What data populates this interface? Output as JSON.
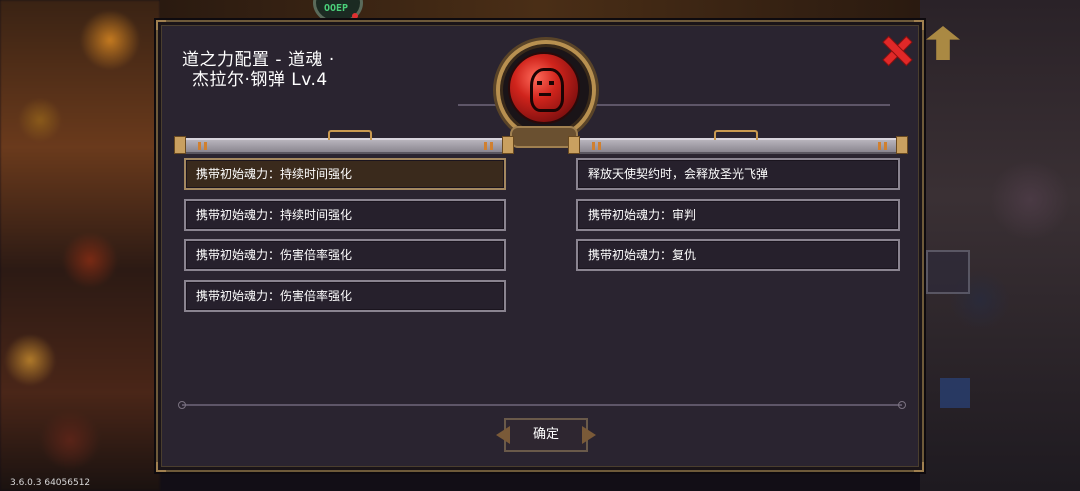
{
  "dialog": {
    "title_line1": "道之力配置 - 道魂 ·",
    "title_line2": "杰拉尔·钢弹 Lv.4",
    "confirm_label": "确定"
  },
  "left_column": [
    {
      "label": "携带初始魂力：持续时间强化",
      "selected": true
    },
    {
      "label": "携带初始魂力：持续时间强化",
      "selected": false
    },
    {
      "label": "携带初始魂力：伤害倍率强化",
      "selected": false
    },
    {
      "label": "携带初始魂力：伤害倍率强化",
      "selected": false
    }
  ],
  "right_column": [
    {
      "label": "释放天使契约时，会释放圣光飞弹"
    },
    {
      "label": "携带初始魂力：审判"
    },
    {
      "label": "携带初始魂力：复仇"
    }
  ],
  "top_badge_text": "OOEP",
  "version_text": "3.6.0.3 64056512",
  "colors": {
    "close": "#e02828",
    "emblem": "#d0241c",
    "selected_entry": "#3a2a1c"
  },
  "icons": {
    "close": "close-icon",
    "emblem": "soul-emblem-icon"
  }
}
